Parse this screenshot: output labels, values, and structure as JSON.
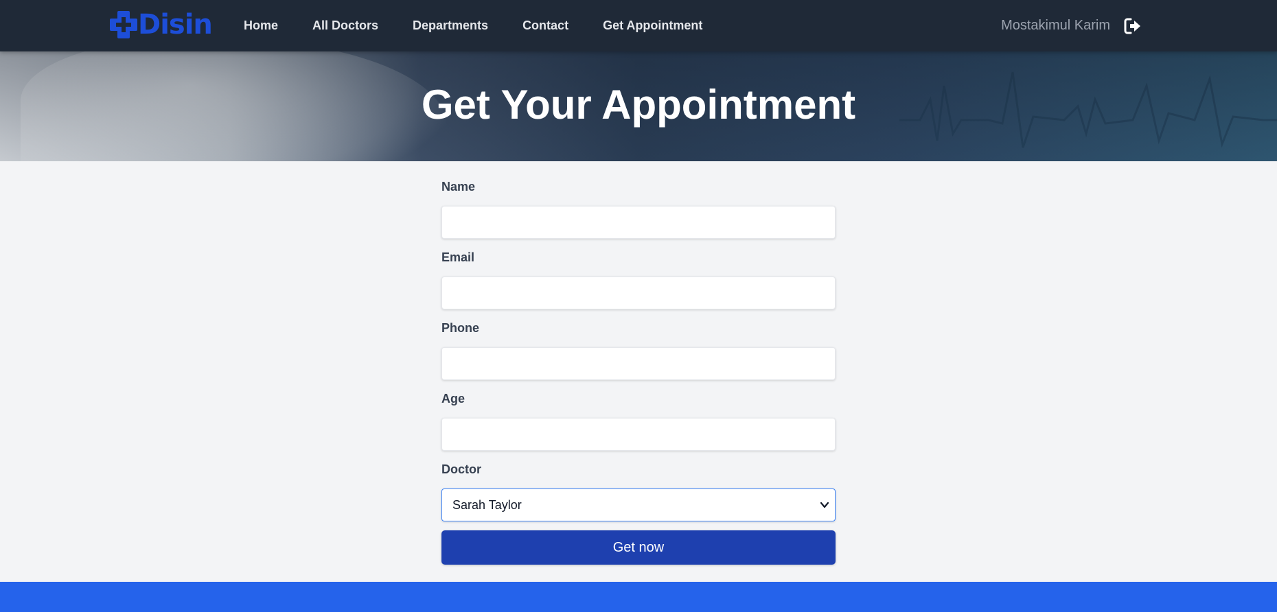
{
  "brand": {
    "name": "Disin",
    "icon": "medical-cross-icon",
    "color": "#1d4ed8"
  },
  "nav": {
    "links": [
      {
        "label": "Home"
      },
      {
        "label": "All Doctors"
      },
      {
        "label": "Departments"
      },
      {
        "label": "Contact"
      },
      {
        "label": "Get Appointment"
      }
    ],
    "user_name": "Mostakimul Karim",
    "logout_icon": "sign-out-icon"
  },
  "hero": {
    "title": "Get Your Appointment"
  },
  "form": {
    "fields": [
      {
        "label": "Name",
        "value": ""
      },
      {
        "label": "Email",
        "value": ""
      },
      {
        "label": "Phone",
        "value": ""
      },
      {
        "label": "Age",
        "value": ""
      }
    ],
    "doctor": {
      "label": "Doctor",
      "selected": "Sarah Taylor"
    },
    "submit_label": "Get now"
  },
  "colors": {
    "navbar_bg": "#1f2937",
    "page_bg": "#f3f4f6",
    "button_bg": "#1e40af",
    "footer_band": "#2563eb",
    "select_focus_border": "#3b82f6"
  }
}
